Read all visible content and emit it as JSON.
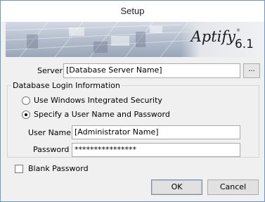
{
  "window": {
    "title": "Setup"
  },
  "banner": {
    "brand": "Aptify",
    "registered": "®",
    "version": "6.1"
  },
  "server": {
    "label": "Server",
    "value": "[Database Server Name]",
    "browse_label": "..."
  },
  "login_group": {
    "title": "Database Login Information",
    "option_windows": "Use Windows Integrated Security",
    "option_user": "Specify a User Name and Password",
    "username_label": "User Name",
    "username_value": "[Administrator Name]",
    "password_label": "Password",
    "password_value": "****************"
  },
  "blank_password": {
    "label": "Blank Password"
  },
  "buttons": {
    "ok": "OK",
    "cancel": "Cancel"
  }
}
